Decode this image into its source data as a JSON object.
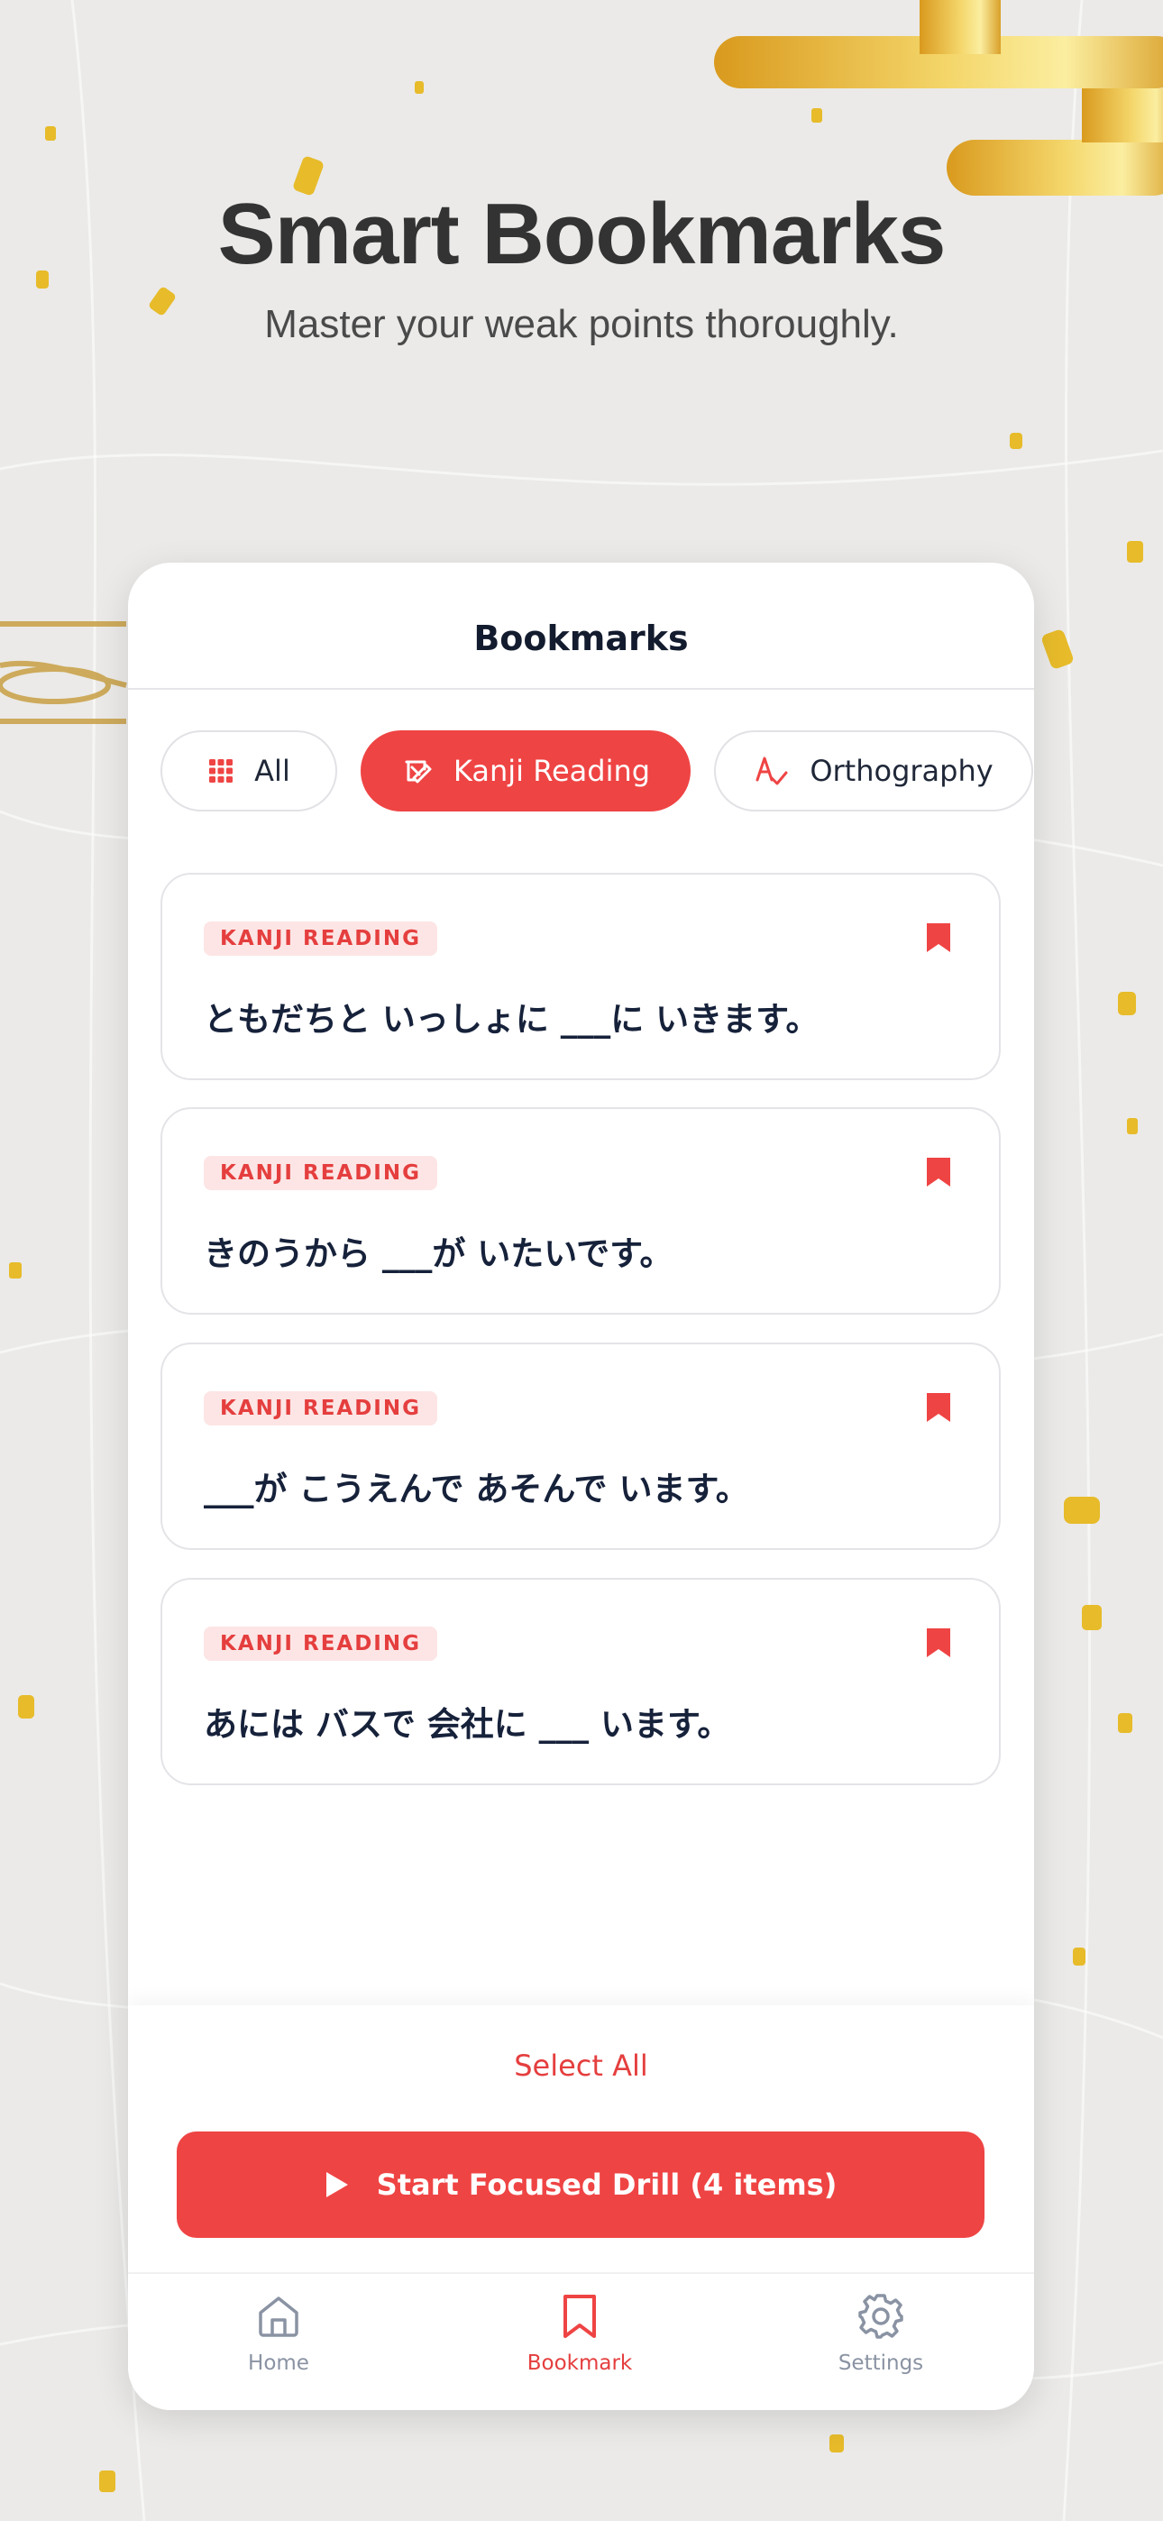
{
  "colors": {
    "accent": "#ef4444",
    "badge_bg": "#fde5e5",
    "text_dark": "#16213a",
    "muted": "#8a93a3"
  },
  "hero": {
    "title": "Smart Bookmarks",
    "subtitle": "Master your weak points thoroughly."
  },
  "screen": {
    "title": "Bookmarks",
    "tabs": [
      {
        "label": "All",
        "icon": "grid-icon",
        "selected": false
      },
      {
        "label": "Kanji Reading",
        "icon": "kanji-pen-icon",
        "selected": true
      },
      {
        "label": "Orthography",
        "icon": "orthography-icon",
        "selected": false
      }
    ],
    "items": [
      {
        "category": "KANJI READING",
        "sentence": "ともだちと いっしょに ___に いきます。",
        "bookmarked": true
      },
      {
        "category": "KANJI READING",
        "sentence": "きのうから ___が いたいです。",
        "bookmarked": true
      },
      {
        "category": "KANJI READING",
        "sentence": "___が こうえんで あそんで います。",
        "bookmarked": true
      },
      {
        "category": "KANJI READING",
        "sentence": "あには バスで 会社に ___ います。",
        "bookmarked": true
      }
    ],
    "select_all": "Select All",
    "drill_button": "Start Focused Drill (4 items)"
  },
  "tabbar": [
    {
      "label": "Home",
      "icon": "home-icon",
      "active": false
    },
    {
      "label": "Bookmark",
      "icon": "bookmark-icon",
      "active": true
    },
    {
      "label": "Settings",
      "icon": "settings-icon",
      "active": false
    }
  ]
}
